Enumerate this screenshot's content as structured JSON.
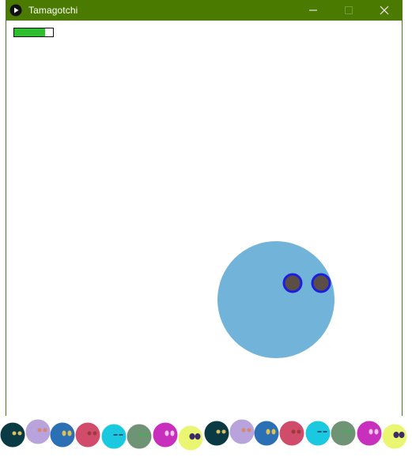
{
  "window": {
    "title": "Tamagotchi",
    "titlebar_color": "#4a7a00",
    "icon": "play-icon",
    "controls": [
      "minimize-icon",
      "maximize-icon",
      "close-icon"
    ]
  },
  "status": {
    "energy_fraction": 0.8,
    "energy_color": "#2fbe2f"
  },
  "pet": {
    "body_color": "#72b4d9",
    "eye_fill": "#5b4f45",
    "eye_ring": "#1e1ee0"
  },
  "creatures": [
    {
      "body": "#0a3b45",
      "eye": "#d9c060",
      "eye_style": "dot"
    },
    {
      "body": "#b8a3dc",
      "eye": "#d8876a",
      "eye_style": "dot"
    },
    {
      "body": "#2b6fb5",
      "eye": "#e0c050",
      "eye_style": "oval"
    },
    {
      "body": "#d14c6a",
      "eye": "#9a3b3b",
      "eye_style": "dot"
    },
    {
      "body": "#1ac8e0",
      "eye": "#1c2a5a",
      "eye_style": "dash"
    },
    {
      "body": "#6e9475",
      "eye": "#2fc04a",
      "eye_style": "dash"
    },
    {
      "body": "#c92fbd",
      "eye": "#f3c6ea",
      "eye_style": "oval"
    },
    {
      "body": "#eaf571",
      "eye": "#3b2a66",
      "eye_style": "big"
    },
    {
      "body": "#0a3b45",
      "eye": "#d9c060",
      "eye_style": "dot"
    },
    {
      "body": "#b8a3dc",
      "eye": "#d8876a",
      "eye_style": "dot"
    },
    {
      "body": "#2b6fb5",
      "eye": "#e0c050",
      "eye_style": "oval"
    },
    {
      "body": "#d14c6a",
      "eye": "#9a3b3b",
      "eye_style": "dot"
    },
    {
      "body": "#1ac8e0",
      "eye": "#1c2a5a",
      "eye_style": "dash"
    },
    {
      "body": "#6e9475",
      "eye": "#2fc04a",
      "eye_style": "dash"
    },
    {
      "body": "#c92fbd",
      "eye": "#f3c6ea",
      "eye_style": "oval"
    },
    {
      "body": "#eaf571",
      "eye": "#3b2a66",
      "eye_style": "big"
    }
  ]
}
